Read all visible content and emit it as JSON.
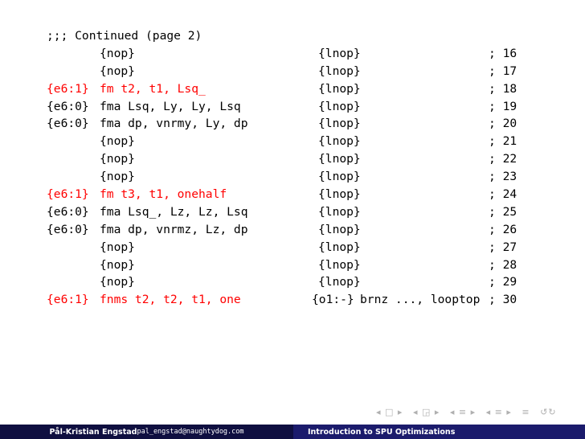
{
  "header": ";;; Continued (page 2)",
  "lines": [
    {
      "tag": "",
      "ins": "{nop}",
      "p2": "",
      "lnop": "{lnop}",
      "num": "; 16",
      "red": false
    },
    {
      "tag": "",
      "ins": "{nop}",
      "p2": "",
      "lnop": "{lnop}",
      "num": "; 17",
      "red": false
    },
    {
      "tag": "{e6:1}",
      "ins": "fm t2, t1, Lsq_",
      "p2": "",
      "lnop": "{lnop}",
      "num": "; 18",
      "red": true
    },
    {
      "tag": "{e6:0}",
      "ins": "fma Lsq, Ly, Ly, Lsq",
      "p2": "",
      "lnop": "{lnop}",
      "num": "; 19",
      "red": false
    },
    {
      "tag": "{e6:0}",
      "ins": "fma dp, vnrmy, Ly, dp",
      "p2": "",
      "lnop": "{lnop}",
      "num": "; 20",
      "red": false
    },
    {
      "tag": "",
      "ins": "{nop}",
      "p2": "",
      "lnop": "{lnop}",
      "num": "; 21",
      "red": false
    },
    {
      "tag": "",
      "ins": "{nop}",
      "p2": "",
      "lnop": "{lnop}",
      "num": "; 22",
      "red": false
    },
    {
      "tag": "",
      "ins": "{nop}",
      "p2": "",
      "lnop": "{lnop}",
      "num": "; 23",
      "red": false
    },
    {
      "tag": "{e6:1}",
      "ins": "fm t3, t1, onehalf",
      "p2": "",
      "lnop": "{lnop}",
      "num": "; 24",
      "red": true
    },
    {
      "tag": "{e6:0}",
      "ins": "fma Lsq_, Lz, Lz, Lsq",
      "p2": "",
      "lnop": "{lnop}",
      "num": "; 25",
      "red": false
    },
    {
      "tag": "{e6:0}",
      "ins": "fma dp, vnrmz, Lz, dp",
      "p2": "",
      "lnop": "{lnop}",
      "num": "; 26",
      "red": false
    },
    {
      "tag": "",
      "ins": "{nop}",
      "p2": "",
      "lnop": "{lnop}",
      "num": "; 27",
      "red": false
    },
    {
      "tag": "",
      "ins": "{nop}",
      "p2": "",
      "lnop": "{lnop}",
      "num": "; 28",
      "red": false
    },
    {
      "tag": "",
      "ins": "{nop}",
      "p2": "",
      "lnop": "{lnop}",
      "num": "; 29",
      "red": false
    },
    {
      "tag": "{e6:1}",
      "ins": "fnms t2, t2, t1, one",
      "p2": "{o1:-}",
      "lnop": "brnz ..., looptop",
      "num": "; 30",
      "red": true
    }
  ],
  "nav_symbols": [
    "◂ □ ▸",
    "◂ ◲ ▸",
    "◂ ≡ ▸",
    "◂ ≡ ▸",
    "≡",
    "↺↻"
  ],
  "footer": {
    "author": "Pål-Kristian Engstad",
    "email": "pal_engstad@naughtydog.com",
    "title": "Introduction to SPU Optimizations"
  },
  "colors": {
    "highlight": "#ff0000",
    "footer_left": "#0f0f40",
    "footer_right": "#1b1b6c"
  }
}
